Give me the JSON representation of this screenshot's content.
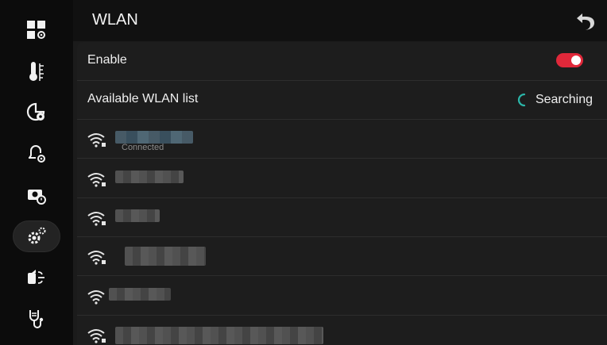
{
  "header": {
    "title": "WLAN"
  },
  "sidebar": {
    "items": [
      {
        "icon": "dashboard-settings-icon",
        "active": false
      },
      {
        "icon": "thermometer-icon",
        "active": false
      },
      {
        "icon": "chart-settings-icon",
        "active": false
      },
      {
        "icon": "alarm-settings-icon",
        "active": false
      },
      {
        "icon": "camera-timer-icon",
        "active": false
      },
      {
        "icon": "gear-icon",
        "active": true
      },
      {
        "icon": "transmission-icon",
        "active": false
      },
      {
        "icon": "stethoscope-icon",
        "active": false
      }
    ]
  },
  "settings": {
    "enable_label": "Enable",
    "enable_on": true,
    "available_label": "Available WLAN list",
    "searching_label": "Searching"
  },
  "wlan_list": [
    {
      "name": "",
      "status": "Connected",
      "blurred": true
    },
    {
      "name": "",
      "status": "",
      "blurred": true
    },
    {
      "name": "",
      "status": "",
      "blurred": true
    },
    {
      "name": "",
      "status": "",
      "blurred": true
    },
    {
      "name": "",
      "status": "",
      "blurred": true
    },
    {
      "name": "",
      "status": "",
      "blurred": true
    }
  ],
  "colors": {
    "accent": "#e0283a",
    "searching_spinner": "#2bb5a8"
  }
}
